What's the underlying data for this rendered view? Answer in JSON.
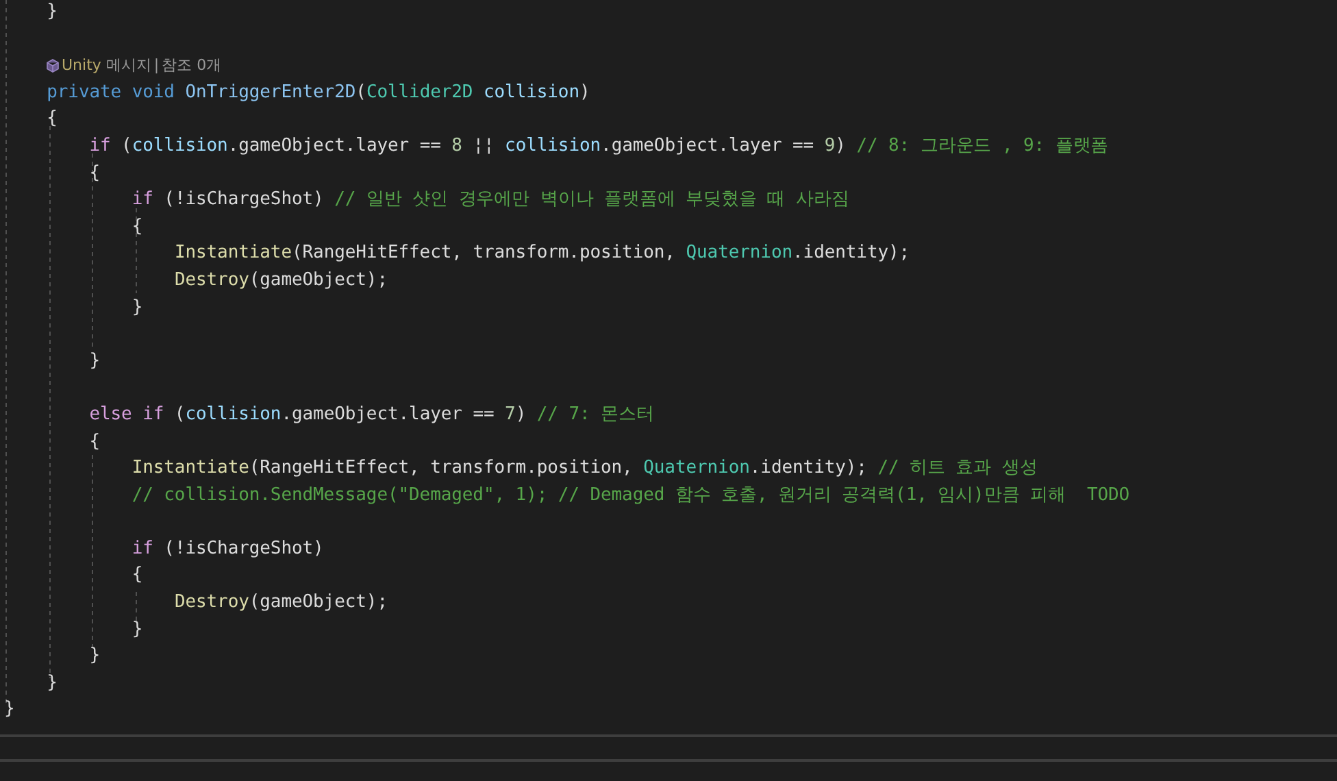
{
  "editor": {
    "lines": [
      {
        "kind": "code",
        "tokens": [
          {
            "kind": "plain",
            "t": "    }"
          }
        ]
      },
      {
        "kind": "blank"
      },
      {
        "kind": "codelens",
        "source": "Unity",
        "text": "메시지",
        "separator": "|",
        "refs": "참조 0개"
      },
      {
        "kind": "code",
        "tokens": [
          {
            "kind": "kw",
            "t": "    private"
          },
          {
            "kind": "kw",
            "t": " void"
          },
          {
            "kind": "decl",
            "t": " OnTriggerEnter2D"
          },
          {
            "kind": "plain",
            "t": "("
          },
          {
            "kind": "type",
            "t": "Collider2D"
          },
          {
            "kind": "var",
            "t": " collision"
          },
          {
            "kind": "plain",
            "t": ")"
          }
        ]
      },
      {
        "kind": "code",
        "tokens": [
          {
            "kind": "plain",
            "t": "    {"
          }
        ]
      },
      {
        "kind": "code",
        "tokens": [
          {
            "kind": "ctl",
            "t": "        if"
          },
          {
            "kind": "plain",
            "t": " ("
          },
          {
            "kind": "var",
            "t": "collision"
          },
          {
            "kind": "plain",
            "t": ".gameObject.layer == "
          },
          {
            "kind": "num",
            "t": "8"
          },
          {
            "kind": "plain",
            "t": " ¦¦ "
          },
          {
            "kind": "var",
            "t": "collision"
          },
          {
            "kind": "plain",
            "t": ".gameObject.layer == "
          },
          {
            "kind": "num",
            "t": "9"
          },
          {
            "kind": "plain",
            "t": ") "
          },
          {
            "kind": "cm",
            "t": "// 8: 그라운드 , 9: 플랫폼"
          }
        ]
      },
      {
        "kind": "code",
        "tokens": [
          {
            "kind": "plain",
            "t": "        {"
          }
        ]
      },
      {
        "kind": "code",
        "tokens": [
          {
            "kind": "ctl",
            "t": "            if"
          },
          {
            "kind": "plain",
            "t": " (!isChargeShot) "
          },
          {
            "kind": "cm",
            "t": "// 일반 샷인 경우에만 벽이나 플랫폼에 부딪혔을 때 사라짐"
          }
        ]
      },
      {
        "kind": "code",
        "tokens": [
          {
            "kind": "plain",
            "t": "            {"
          }
        ]
      },
      {
        "kind": "code",
        "tokens": [
          {
            "kind": "fn",
            "t": "                Instantiate"
          },
          {
            "kind": "plain",
            "t": "(RangeHitEffect, transform.position, "
          },
          {
            "kind": "type",
            "t": "Quaternion"
          },
          {
            "kind": "plain",
            "t": ".identity);"
          }
        ]
      },
      {
        "kind": "code",
        "tokens": [
          {
            "kind": "fn",
            "t": "                Destroy"
          },
          {
            "kind": "plain",
            "t": "(gameObject);"
          }
        ]
      },
      {
        "kind": "code",
        "tokens": [
          {
            "kind": "plain",
            "t": "            }"
          }
        ]
      },
      {
        "kind": "blank"
      },
      {
        "kind": "code",
        "tokens": [
          {
            "kind": "plain",
            "t": "        }"
          }
        ]
      },
      {
        "kind": "blank"
      },
      {
        "kind": "code",
        "tokens": [
          {
            "kind": "ctl",
            "t": "        else if"
          },
          {
            "kind": "plain",
            "t": " ("
          },
          {
            "kind": "var",
            "t": "collision"
          },
          {
            "kind": "plain",
            "t": ".gameObject.layer == "
          },
          {
            "kind": "num",
            "t": "7"
          },
          {
            "kind": "plain",
            "t": ") "
          },
          {
            "kind": "cm",
            "t": "// 7: 몬스터"
          }
        ]
      },
      {
        "kind": "code",
        "tokens": [
          {
            "kind": "plain",
            "t": "        {"
          }
        ]
      },
      {
        "kind": "code",
        "tokens": [
          {
            "kind": "fn",
            "t": "            Instantiate"
          },
          {
            "kind": "plain",
            "t": "(RangeHitEffect, transform.position, "
          },
          {
            "kind": "type",
            "t": "Quaternion"
          },
          {
            "kind": "plain",
            "t": ".identity); "
          },
          {
            "kind": "cm",
            "t": "// 히트 효과 생성"
          }
        ]
      },
      {
        "kind": "code",
        "tokens": [
          {
            "kind": "cm",
            "t": "            // collision.SendMessage(\"Demaged\", 1); // Demaged 함수 호출, 원거리 공격력(1, 임시)만큼 피해  TODO"
          }
        ]
      },
      {
        "kind": "blank"
      },
      {
        "kind": "code",
        "tokens": [
          {
            "kind": "ctl",
            "t": "            if"
          },
          {
            "kind": "plain",
            "t": " (!isChargeShot)"
          }
        ]
      },
      {
        "kind": "code",
        "tokens": [
          {
            "kind": "plain",
            "t": "            {"
          }
        ]
      },
      {
        "kind": "code",
        "tokens": [
          {
            "kind": "fn",
            "t": "                Destroy"
          },
          {
            "kind": "plain",
            "t": "(gameObject);"
          }
        ]
      },
      {
        "kind": "code",
        "tokens": [
          {
            "kind": "plain",
            "t": "            }"
          }
        ]
      },
      {
        "kind": "code",
        "tokens": [
          {
            "kind": "plain",
            "t": "        }"
          }
        ]
      },
      {
        "kind": "code",
        "tokens": [
          {
            "kind": "plain",
            "t": "    }"
          }
        ]
      },
      {
        "kind": "code",
        "tokens": [
          {
            "kind": "plain",
            "t": "}"
          }
        ]
      }
    ]
  }
}
